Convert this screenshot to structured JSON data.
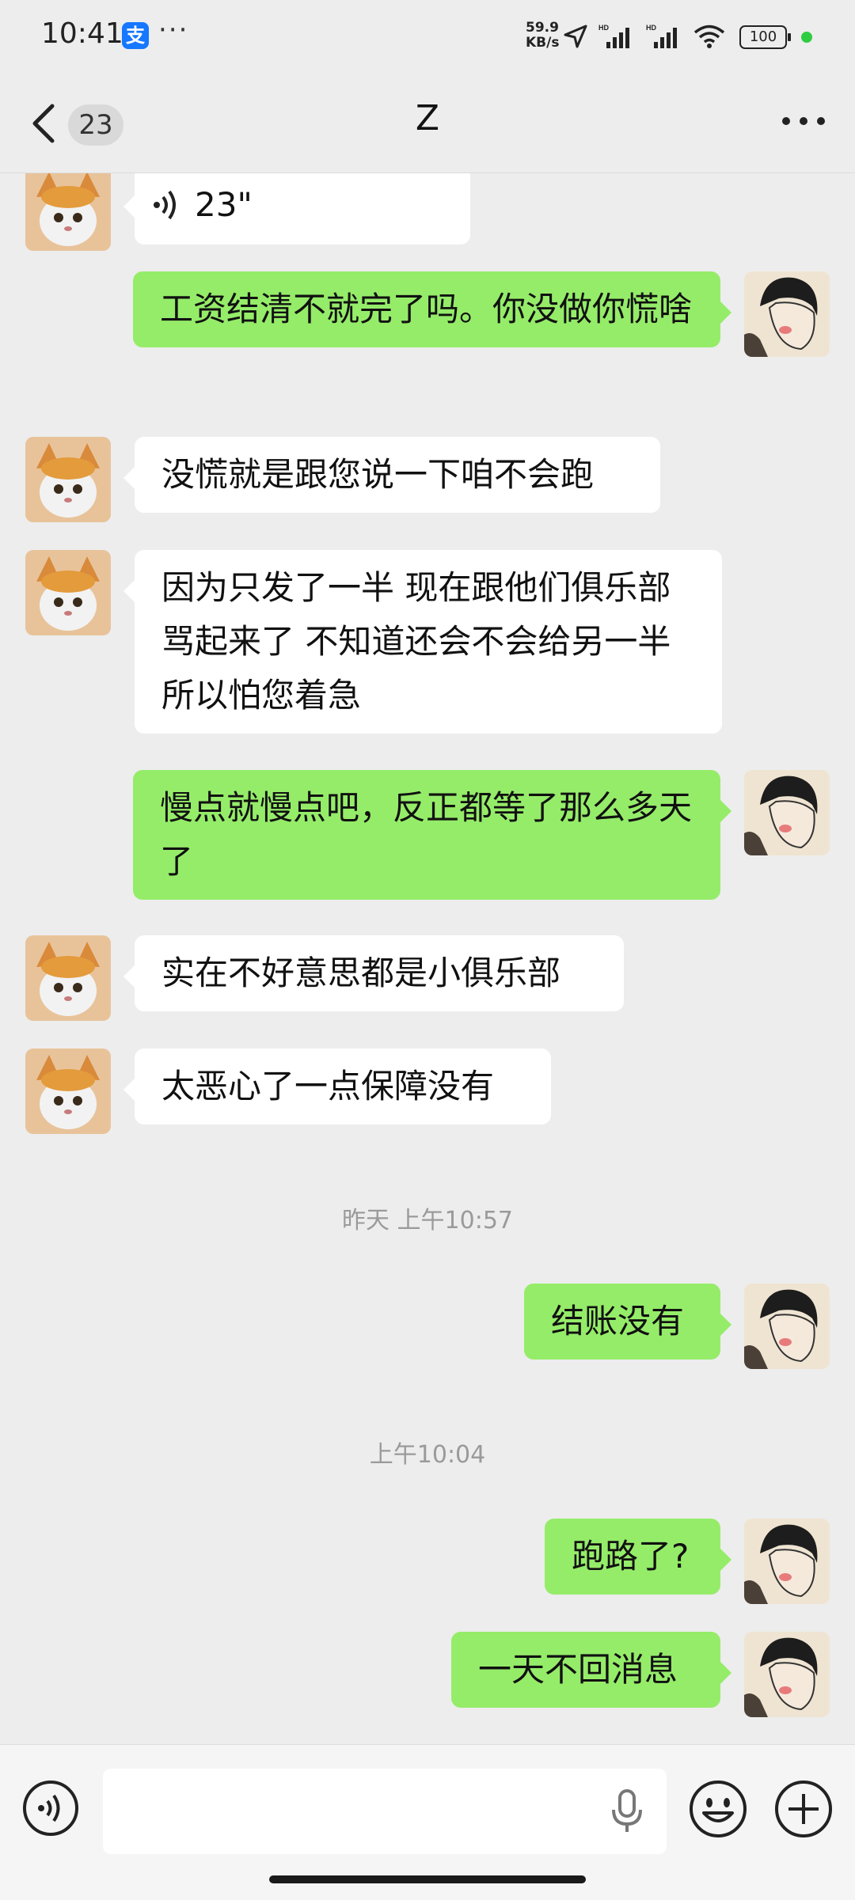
{
  "status_bar": {
    "time": "10:41",
    "app_icon": "支",
    "more": "···",
    "net_speed_value": "59.9",
    "net_speed_unit": "KB/s",
    "battery": "100"
  },
  "header": {
    "unread_count": "23",
    "title": "Z"
  },
  "messages": [
    {
      "side": "left",
      "type": "voice",
      "duration": "23\""
    },
    {
      "side": "right",
      "text": "工资结清不就完了吗。你没做你慌啥"
    },
    {
      "side": "left",
      "text": "没慌就是跟您说一下咱不会跑"
    },
    {
      "side": "left",
      "text": "因为只发了一半 现在跟他们俱乐部骂起来了 不知道还会不会给另一半 所以怕您着急"
    },
    {
      "side": "right",
      "text": "慢点就慢点吧，反正都等了那么多天了"
    },
    {
      "side": "left",
      "text": "实在不好意思都是小俱乐部"
    },
    {
      "side": "left",
      "text": "太恶心了一点保障没有"
    },
    {
      "type": "timestamp",
      "text": "昨天 上午10:57"
    },
    {
      "side": "right",
      "text": "结账没有"
    },
    {
      "type": "timestamp",
      "text": "上午10:04"
    },
    {
      "side": "right",
      "text": "跑路了?"
    },
    {
      "side": "right",
      "text": "一天不回消息"
    }
  ],
  "input_bar": {
    "placeholder": ""
  },
  "colors": {
    "background": "#ededed",
    "sent_bubble": "#95ec69",
    "received_bubble": "#ffffff"
  },
  "icons": [
    "back-icon",
    "more-icon",
    "voice-wave-icon",
    "microphone-icon",
    "emoji-icon",
    "plus-icon",
    "location-icon",
    "signal-icon",
    "wifi-icon"
  ]
}
